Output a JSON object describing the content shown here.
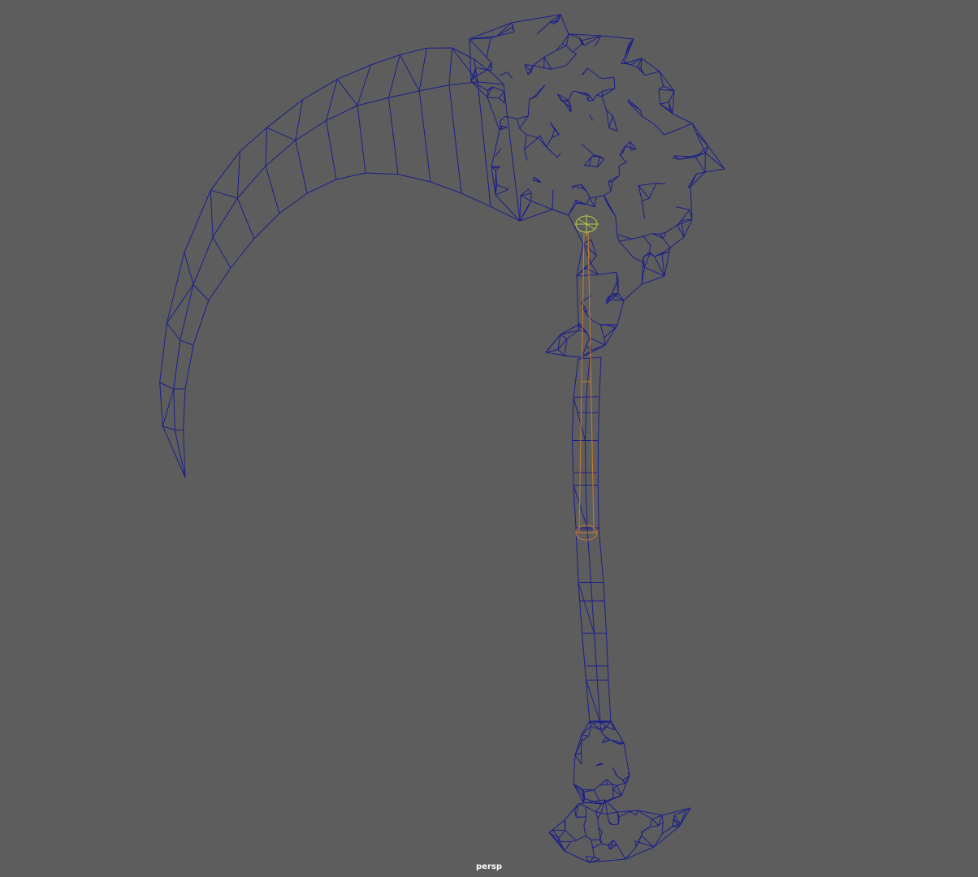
{
  "viewport": {
    "camera_label": "persp",
    "colors": {
      "background": "#5d5d5d",
      "wireframe": "#1b1f8a",
      "joint": "#c97a33",
      "locator": "#b8c94a"
    }
  }
}
